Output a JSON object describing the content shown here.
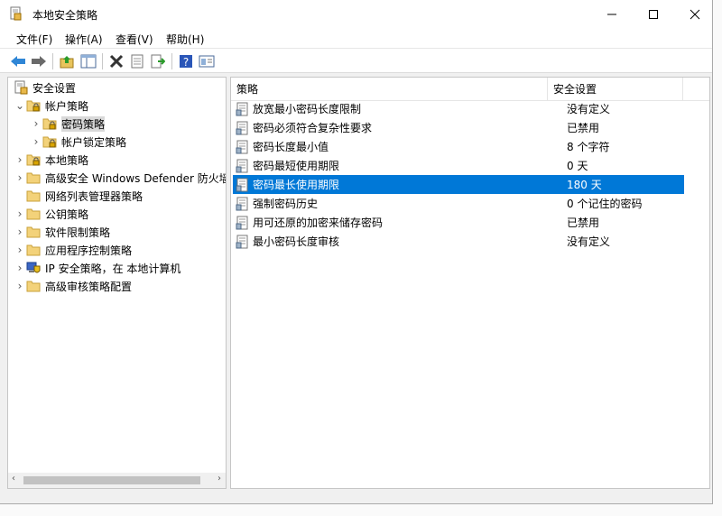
{
  "window": {
    "title": "本地安全策略"
  },
  "menu": [
    "文件(F)",
    "操作(A)",
    "查看(V)",
    "帮助(H)"
  ],
  "toolbar": [
    "back-arrow-icon",
    "forward-arrow-icon",
    "up-folder-icon",
    "show-hide-tree-icon",
    "delete-icon",
    "properties-icon",
    "export-list-icon",
    "help-icon",
    "mmc-view-icon"
  ],
  "tree": [
    {
      "label": "安全设置",
      "indent": 0,
      "chevron": "",
      "icon": "security-settings-icon"
    },
    {
      "label": "帐户策略",
      "indent": 1,
      "chevron": "⌄",
      "icon": "folder-lock-icon"
    },
    {
      "label": "密码策略",
      "indent": 2,
      "chevron": "›",
      "icon": "folder-lock-icon",
      "selected": true
    },
    {
      "label": "帐户锁定策略",
      "indent": 2,
      "chevron": "›",
      "icon": "folder-lock-icon"
    },
    {
      "label": "本地策略",
      "indent": 1,
      "chevron": "›",
      "icon": "folder-lock-icon"
    },
    {
      "label": "高级安全 Windows Defender 防火墙",
      "indent": 1,
      "chevron": "›",
      "icon": "folder-icon"
    },
    {
      "label": "网络列表管理器策略",
      "indent": 1,
      "chevron": "",
      "icon": "folder-icon"
    },
    {
      "label": "公钥策略",
      "indent": 1,
      "chevron": "›",
      "icon": "folder-icon"
    },
    {
      "label": "软件限制策略",
      "indent": 1,
      "chevron": "›",
      "icon": "folder-icon"
    },
    {
      "label": "应用程序控制策略",
      "indent": 1,
      "chevron": "›",
      "icon": "folder-icon"
    },
    {
      "label": "IP 安全策略，在 本地计算机",
      "indent": 1,
      "chevron": "›",
      "icon": "ip-security-icon"
    },
    {
      "label": "高级审核策略配置",
      "indent": 1,
      "chevron": "›",
      "icon": "folder-icon"
    }
  ],
  "columns": {
    "policy": "策略",
    "setting": "安全设置"
  },
  "policies": [
    {
      "name": "放宽最小密码长度限制",
      "value": "没有定义"
    },
    {
      "name": "密码必须符合复杂性要求",
      "value": "已禁用"
    },
    {
      "name": "密码长度最小值",
      "value": "8 个字符"
    },
    {
      "name": "密码最短使用期限",
      "value": "0 天"
    },
    {
      "name": "密码最长使用期限",
      "value": "180 天",
      "selected": true
    },
    {
      "name": "强制密码历史",
      "value": "0 个记住的密码"
    },
    {
      "name": "用可还原的加密来储存密码",
      "value": "已禁用"
    },
    {
      "name": "最小密码长度审核",
      "value": "没有定义"
    }
  ],
  "colors": {
    "selection": "#0078d7",
    "tree_selection": "#d9d9d9"
  }
}
